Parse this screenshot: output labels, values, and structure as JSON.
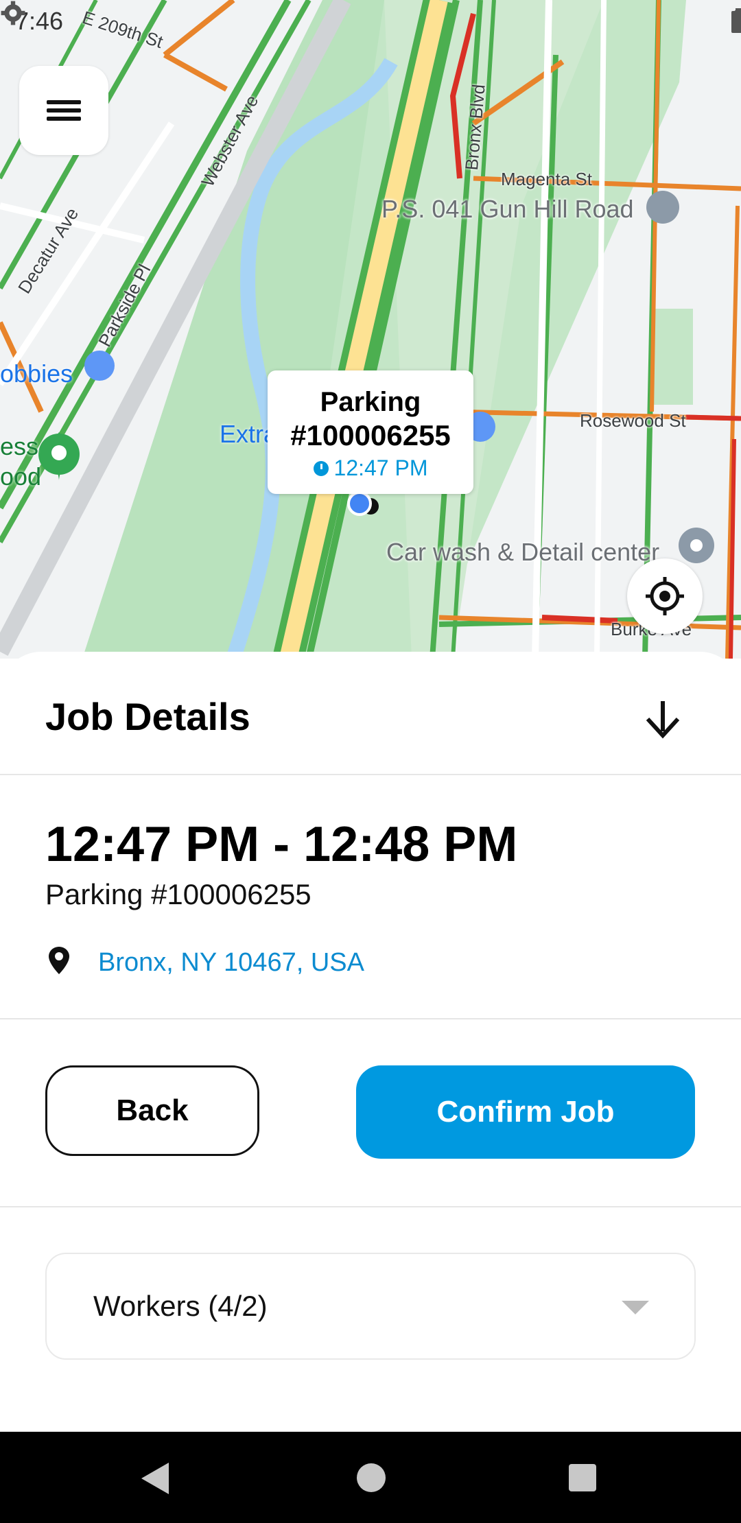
{
  "status_bar": {
    "time": "7:46"
  },
  "map": {
    "labels": {
      "school": "P.S. 041 Gun Hill Road",
      "carwash": "Car wash & Detail center",
      "hobbies": "obbies",
      "extra": "Extra",
      "ess": "ess",
      "ood": "ood",
      "st_209": "E 209th St",
      "webster": "Webster Ave",
      "bronx_blvd": "Bronx Blvd",
      "magenta": "Magenta St",
      "decatur": "Decatur Ave",
      "parkside": "Parkside Pl",
      "rosewood": "Rosewood St",
      "burke": "Burke Ave"
    },
    "popup": {
      "line1": "Parking",
      "line2": "#100006255",
      "time": "12:47 PM"
    }
  },
  "sheet": {
    "title": "Job Details",
    "time_range": "12:47 PM - 12:48 PM",
    "job_name": "Parking #100006255",
    "address": "Bronx, NY 10467, USA",
    "back_label": "Back",
    "confirm_label": "Confirm Job",
    "workers_label": "Workers (4/2)"
  },
  "colors": {
    "accent": "#0099e0",
    "link": "#0c8bd0"
  }
}
